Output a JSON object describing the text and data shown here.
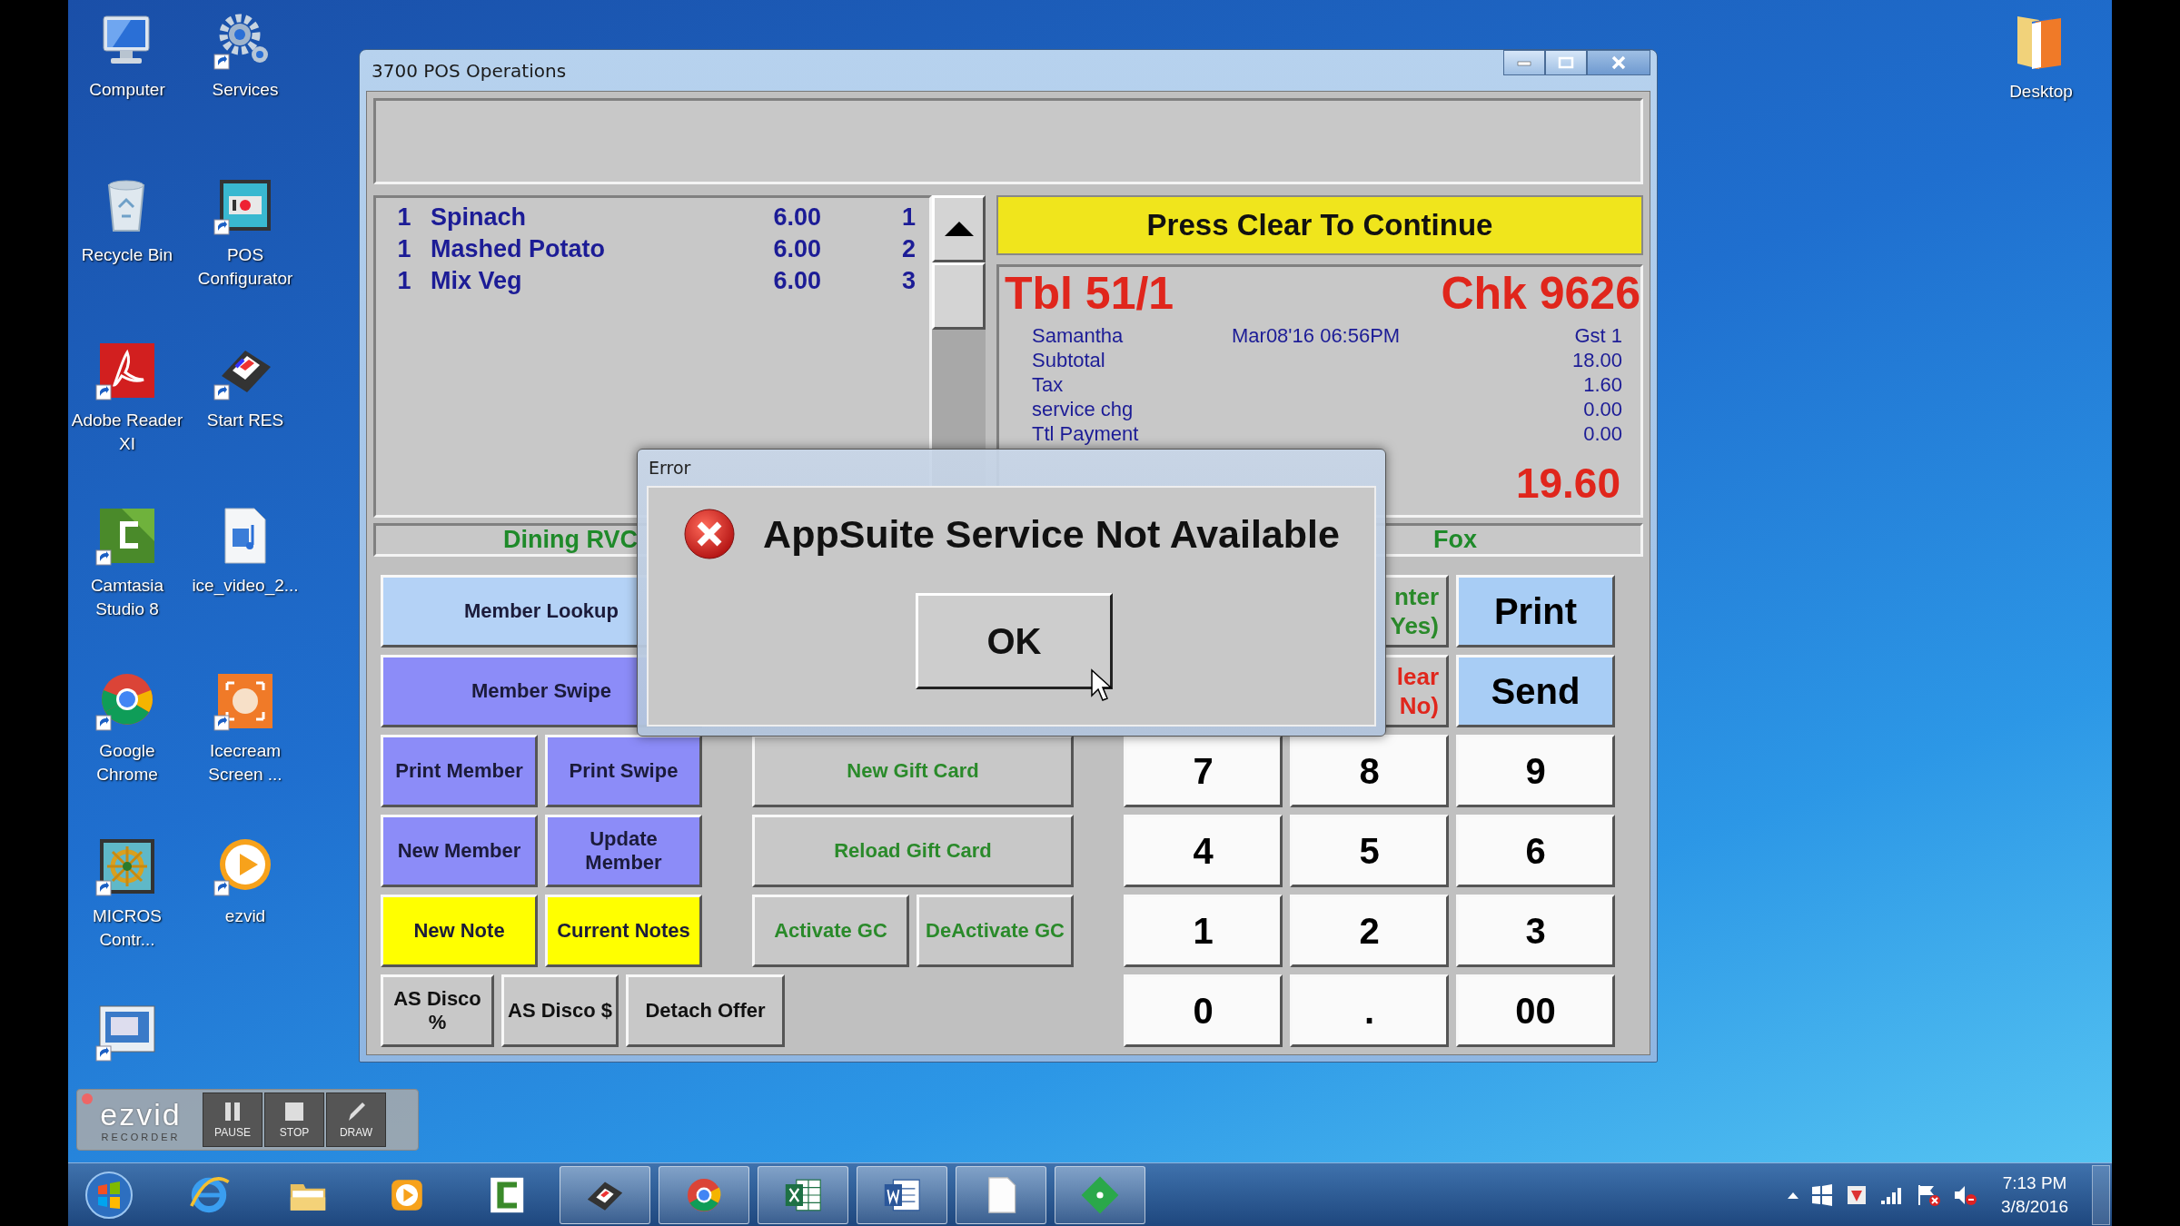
{
  "desktop_icons": [
    {
      "label": "Computer"
    },
    {
      "label": "Services"
    },
    {
      "label": "Recycle Bin"
    },
    {
      "label": "POS Configurator"
    },
    {
      "label": "Adobe Reader XI"
    },
    {
      "label": "Start RES"
    },
    {
      "label": "Camtasia Studio 8"
    },
    {
      "label": "ice_video_2..."
    },
    {
      "label": "Google Chrome"
    },
    {
      "label": "Icecream Screen ..."
    },
    {
      "label": "MICROS Contr..."
    },
    {
      "label": "ezvid"
    }
  ],
  "desktop_shortcut": {
    "label": "Desktop"
  },
  "pos_window": {
    "title": "3700 POS Operations",
    "order_items": [
      {
        "qty": "1",
        "name": "Spinach",
        "price": "6.00",
        "seat": "1"
      },
      {
        "qty": "1",
        "name": "Mashed Potato",
        "price": "6.00",
        "seat": "2"
      },
      {
        "qty": "1",
        "name": "Mix Veg",
        "price": "6.00",
        "seat": "3"
      }
    ],
    "banner": "Press Clear To Continue",
    "check": {
      "table": "Tbl 51/1",
      "number": "Chk 9626",
      "server": "Samantha",
      "opened": "Mar08'16 06:56PM",
      "guests": "Gst 1",
      "lines": [
        {
          "label": "Subtotal",
          "amount": "18.00"
        },
        {
          "label": "Tax",
          "amount": "1.60"
        },
        {
          "label": "service chg",
          "amount": "0.00"
        },
        {
          "label": "Ttl Payment",
          "amount": "0.00"
        }
      ],
      "total": "19.60"
    },
    "status_left": "Dining RVC",
    "status_right": "Fox",
    "member_buttons": [
      {
        "label": "Member Lookup",
        "kind": "light"
      },
      {
        "label": "Member Swipe",
        "kind": "blue"
      },
      {
        "label": "Print Member",
        "kind": "blue"
      },
      {
        "label": "Print Swipe",
        "kind": "blue"
      },
      {
        "label": "New Member",
        "kind": "blue"
      },
      {
        "label": "Update\nMember",
        "kind": "blue"
      },
      {
        "label": "New Note",
        "kind": "yellow"
      },
      {
        "label": "Current Notes",
        "kind": "yellow"
      }
    ],
    "discount_buttons": [
      {
        "label": "AS Disco\n%",
        "kind": "plain"
      },
      {
        "label": "AS Disco $",
        "kind": "plain"
      },
      {
        "label": "Detach Offer",
        "kind": "plain"
      }
    ],
    "gift_buttons": [
      {
        "label": "New Gift Card",
        "kind": "gift"
      },
      {
        "label": "Reload Gift Card",
        "kind": "gift"
      },
      {
        "label": "Activate GC",
        "kind": "gift"
      },
      {
        "label": "DeActivate GC",
        "kind": "gift"
      }
    ],
    "action_buttons": [
      {
        "label": "nter\nYes)",
        "kind": "enter"
      },
      {
        "label": "Print",
        "kind": "action"
      },
      {
        "label": "lear\nNo)",
        "kind": "clear"
      },
      {
        "label": "Send",
        "kind": "action"
      }
    ],
    "keypad": [
      "7",
      "8",
      "9",
      "4",
      "5",
      "6",
      "1",
      "2",
      "3",
      "0",
      ".",
      "00"
    ]
  },
  "dialog": {
    "title": "Error",
    "message": "AppSuite Service Not Available",
    "button": "OK"
  },
  "recorder": {
    "logo": "ezvid",
    "subtitle": "RECORDER",
    "buttons": [
      "PAUSE",
      "STOP",
      "DRAW"
    ]
  },
  "taskbar": {
    "apps": [
      {
        "running": false
      },
      {
        "running": false
      },
      {
        "running": false
      },
      {
        "running": false
      },
      {
        "running": true
      },
      {
        "running": true
      },
      {
        "running": true
      },
      {
        "running": true
      },
      {
        "running": true
      },
      {
        "running": true
      }
    ],
    "clock": {
      "time": "7:13 PM",
      "date": "3/8/2016"
    }
  }
}
